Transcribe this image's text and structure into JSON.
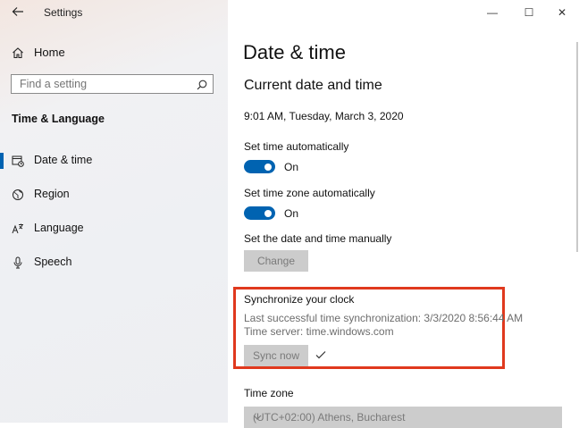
{
  "window": {
    "app_title": "Settings",
    "controls": {
      "minimize": "—",
      "maximize": "☐",
      "close": "✕"
    }
  },
  "sidebar": {
    "home_label": "Home",
    "search_placeholder": "Find a setting",
    "section_title": "Time & Language",
    "items": [
      {
        "label": "Date & time",
        "icon": "calendar-clock-icon",
        "active": true
      },
      {
        "label": "Region",
        "icon": "globe-icon",
        "active": false
      },
      {
        "label": "Language",
        "icon": "language-icon",
        "active": false
      },
      {
        "label": "Speech",
        "icon": "microphone-icon",
        "active": false
      }
    ]
  },
  "main": {
    "page_title": "Date & time",
    "subtitle": "Current date and time",
    "current_datetime": "9:01 AM, Tuesday, March 3, 2020",
    "set_time_auto": {
      "label": "Set time automatically",
      "state": "On"
    },
    "set_tz_auto": {
      "label": "Set time zone automatically",
      "state": "On"
    },
    "manual": {
      "label": "Set the date and time manually",
      "button": "Change"
    },
    "sync": {
      "title": "Synchronize your clock",
      "last_sync": "Last successful time synchronization: 3/3/2020 8:56:44 AM",
      "server": "Time server: time.windows.com",
      "button": "Sync now"
    },
    "timezone": {
      "label": "Time zone",
      "value": "(UTC+02:00) Athens, Bucharest"
    }
  },
  "colors": {
    "accent": "#0063b1",
    "highlight": "#e0391e",
    "disabled_bg": "#cccccc"
  }
}
